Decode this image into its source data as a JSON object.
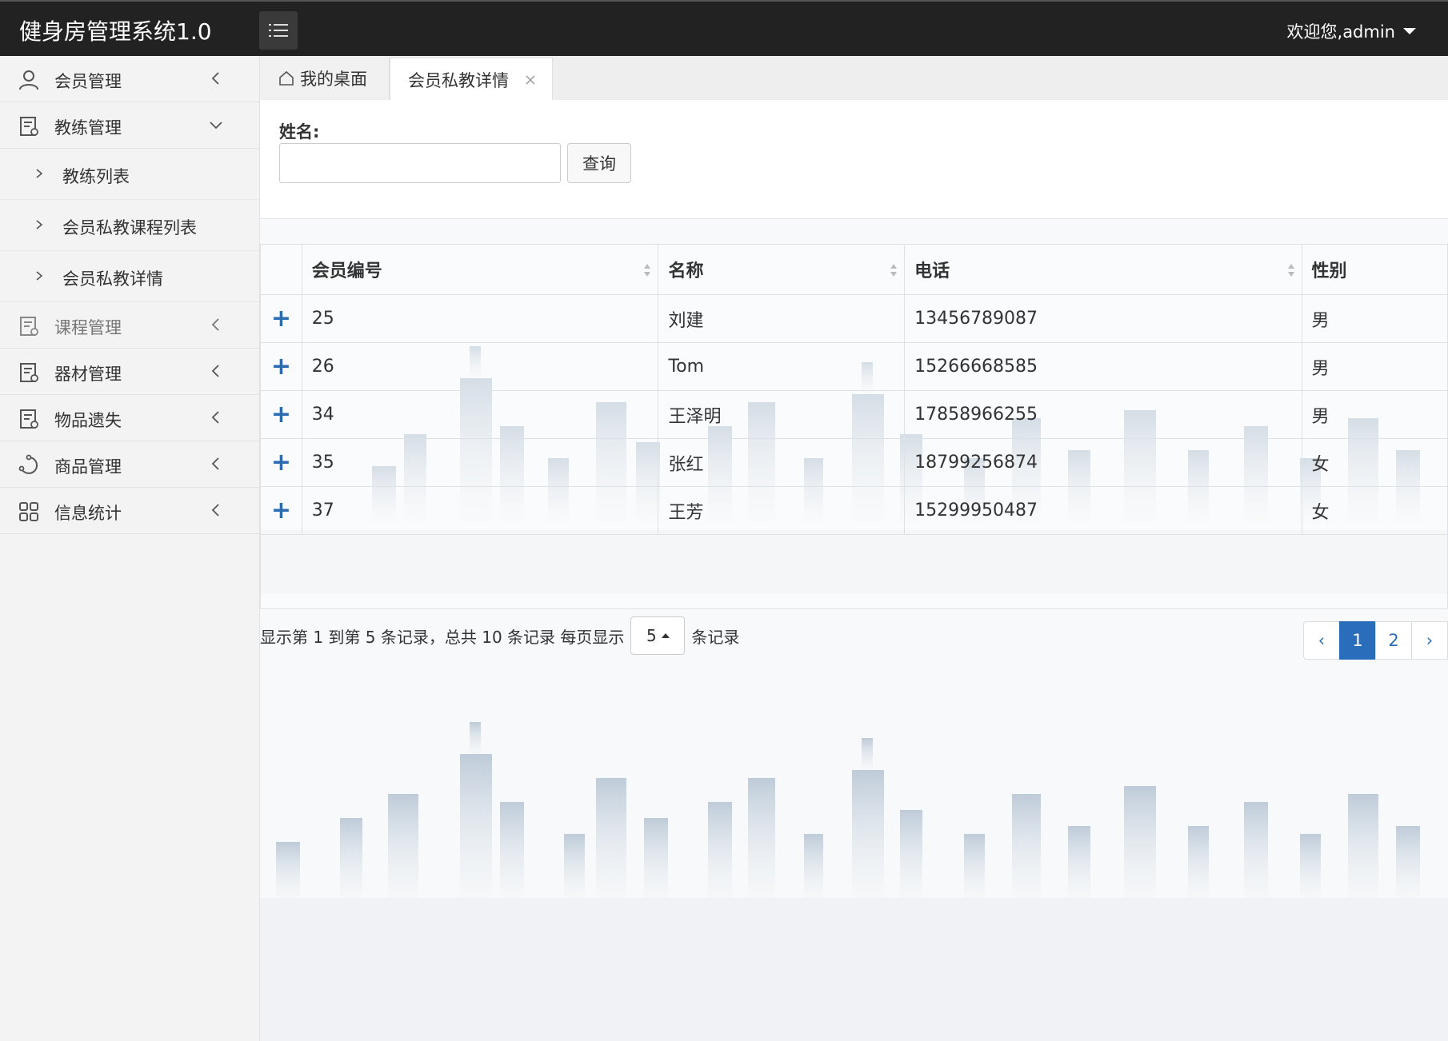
{
  "app": {
    "title": "健身房管理系统1.0",
    "welcome": "欢迎您,admin"
  },
  "sidebar": {
    "items": [
      {
        "label": "会员管理",
        "icon": "user-icon"
      },
      {
        "label": "教练管理",
        "icon": "document-icon",
        "expanded": true,
        "children": [
          "教练列表",
          "会员私教课程列表",
          "会员私教详情"
        ]
      },
      {
        "label": "课程管理",
        "icon": "document-icon"
      },
      {
        "label": "器材管理",
        "icon": "document-icon"
      },
      {
        "label": "物品遗失",
        "icon": "document-icon"
      },
      {
        "label": "商品管理",
        "icon": "recycle-icon"
      },
      {
        "label": "信息统计",
        "icon": "grid-icon"
      }
    ]
  },
  "tabs": [
    {
      "label": "我的桌面",
      "icon": "home-icon"
    },
    {
      "label": "会员私教详情",
      "active": true
    }
  ],
  "search": {
    "label": "姓名:",
    "value": "",
    "button": "查询"
  },
  "table": {
    "headers": [
      "会员编号",
      "名称",
      "电话",
      "性别"
    ],
    "rows": [
      [
        "25",
        "刘建",
        "13456789087",
        "男"
      ],
      [
        "26",
        "Tom",
        "15266668585",
        "男"
      ],
      [
        "34",
        "王泽明",
        "17858966255",
        "男"
      ],
      [
        "35",
        "张红",
        "18799256874",
        "女"
      ],
      [
        "37",
        "王芳",
        "15299950487",
        "女"
      ]
    ]
  },
  "pager": {
    "summary": "显示第 1 到第 5 条记录，总共 10 条记录 每页显示",
    "page_size": "5",
    "suffix": "条记录",
    "prev": "‹",
    "pages": [
      "1",
      "2"
    ],
    "next": "›"
  },
  "colors": {
    "topbar": "#222222",
    "accent": "#2a6ebb"
  }
}
